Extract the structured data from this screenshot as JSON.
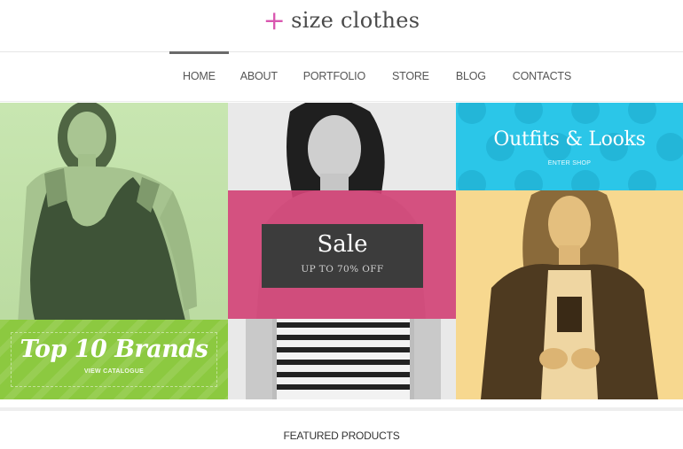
{
  "header": {
    "logo_mark": "+",
    "logo_text": "size clothes"
  },
  "nav": {
    "items": [
      {
        "label": "HOME",
        "active": true
      },
      {
        "label": "ABOUT",
        "active": false
      },
      {
        "label": "PORTFOLIO",
        "active": false
      },
      {
        "label": "STORE",
        "active": false
      },
      {
        "label": "BLOG",
        "active": false
      },
      {
        "label": "CONTACTS",
        "active": false
      }
    ]
  },
  "tiles": {
    "brands": {
      "title": "Top 10 Brands",
      "link": "VIEW CATALOGUE",
      "color": "#8cc940"
    },
    "sale": {
      "title": "Sale",
      "subtitle": "UP TO 70% OFF",
      "panel_color": "#d14376",
      "box_color": "#3c3c3c"
    },
    "outfits": {
      "title": "Outfits & Looks",
      "link": "ENTER SHOP",
      "color": "#2bc6e8"
    }
  },
  "featured": {
    "heading": "FEATURED PRODUCTS"
  },
  "colors": {
    "accent_pink": "#d957b0",
    "green_bg": "#c8e6b1",
    "yellow_bg": "#f7d88f"
  }
}
